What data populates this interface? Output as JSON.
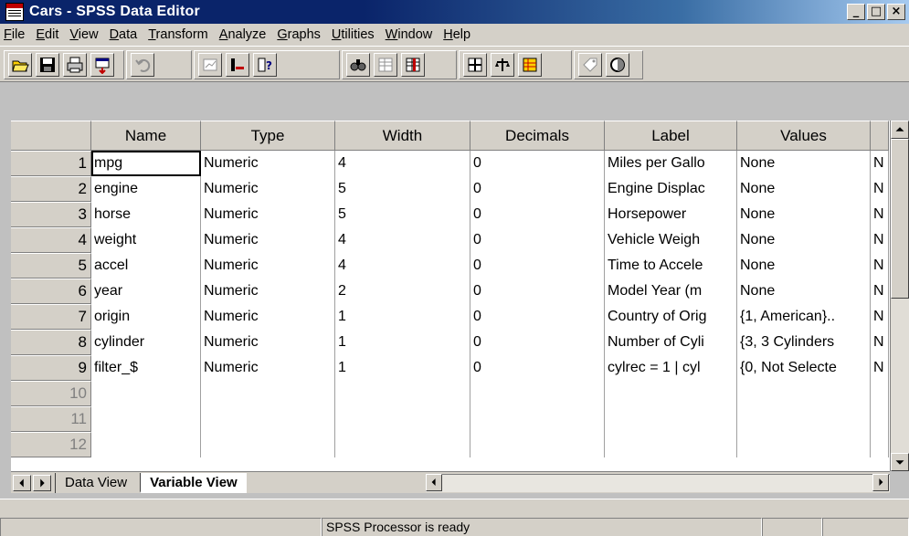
{
  "window": {
    "title": "Cars - SPSS Data Editor",
    "min": "_",
    "max": "□",
    "close": "×"
  },
  "menu": [
    {
      "pre": "",
      "u": "F",
      "post": "ile"
    },
    {
      "pre": "",
      "u": "E",
      "post": "dit"
    },
    {
      "pre": "",
      "u": "V",
      "post": "iew"
    },
    {
      "pre": "",
      "u": "D",
      "post": "ata"
    },
    {
      "pre": "",
      "u": "T",
      "post": "ransform"
    },
    {
      "pre": "",
      "u": "A",
      "post": "nalyze"
    },
    {
      "pre": "",
      "u": "G",
      "post": "raphs"
    },
    {
      "pre": "",
      "u": "U",
      "post": "tilities"
    },
    {
      "pre": "",
      "u": "W",
      "post": "indow"
    },
    {
      "pre": "",
      "u": "H",
      "post": "elp"
    }
  ],
  "toolbar_icons": [
    "open-folder-icon",
    "save-disk-icon",
    "print-icon",
    "dialog-recall-icon",
    "undo-icon",
    "goto-chart-icon",
    "goto-case-icon",
    "variables-icon",
    "find-icon",
    "insert-case-icon",
    "insert-variable-icon",
    "split-file-icon",
    "weight-cases-icon",
    "select-cases-icon",
    "value-labels-icon",
    "use-sets-icon"
  ],
  "grid": {
    "columns": [
      "Name",
      "Type",
      "Width",
      "Decimals",
      "Label",
      "Values",
      ""
    ],
    "rows": [
      {
        "num": "1",
        "cells": [
          "mpg",
          "Numeric",
          "4",
          "0",
          "Miles per Gallo",
          "None",
          "N"
        ]
      },
      {
        "num": "2",
        "cells": [
          "engine",
          "Numeric",
          "5",
          "0",
          "Engine Displac",
          "None",
          "N"
        ]
      },
      {
        "num": "3",
        "cells": [
          "horse",
          "Numeric",
          "5",
          "0",
          "Horsepower",
          "None",
          "N"
        ]
      },
      {
        "num": "4",
        "cells": [
          "weight",
          "Numeric",
          "4",
          "0",
          "Vehicle Weigh",
          "None",
          "N"
        ]
      },
      {
        "num": "5",
        "cells": [
          "accel",
          "Numeric",
          "4",
          "0",
          "Time to Accele",
          "None",
          "N"
        ]
      },
      {
        "num": "6",
        "cells": [
          "year",
          "Numeric",
          "2",
          "0",
          "Model Year (m",
          "None",
          "N"
        ]
      },
      {
        "num": "7",
        "cells": [
          "origin",
          "Numeric",
          "1",
          "0",
          "Country of Orig",
          "{1, American}..",
          "N"
        ]
      },
      {
        "num": "8",
        "cells": [
          "cylinder",
          "Numeric",
          "1",
          "0",
          "Number of Cyli",
          "{3, 3 Cylinders",
          "N"
        ]
      },
      {
        "num": "9",
        "cells": [
          "filter_$",
          "Numeric",
          "1",
          "0",
          "cylrec = 1 | cyl",
          "{0, Not Selecte",
          "N"
        ]
      },
      {
        "num": "10",
        "cells": [
          "",
          "",
          "",
          "",
          "",
          "",
          ""
        ]
      },
      {
        "num": "11",
        "cells": [
          "",
          "",
          "",
          "",
          "",
          "",
          ""
        ]
      },
      {
        "num": "12",
        "cells": [
          "",
          "",
          "",
          "",
          "",
          "",
          ""
        ]
      }
    ]
  },
  "tabs": {
    "data_view": "Data View",
    "variable_view": "Variable View"
  },
  "status": {
    "processor": "SPSS Processor  is ready"
  }
}
